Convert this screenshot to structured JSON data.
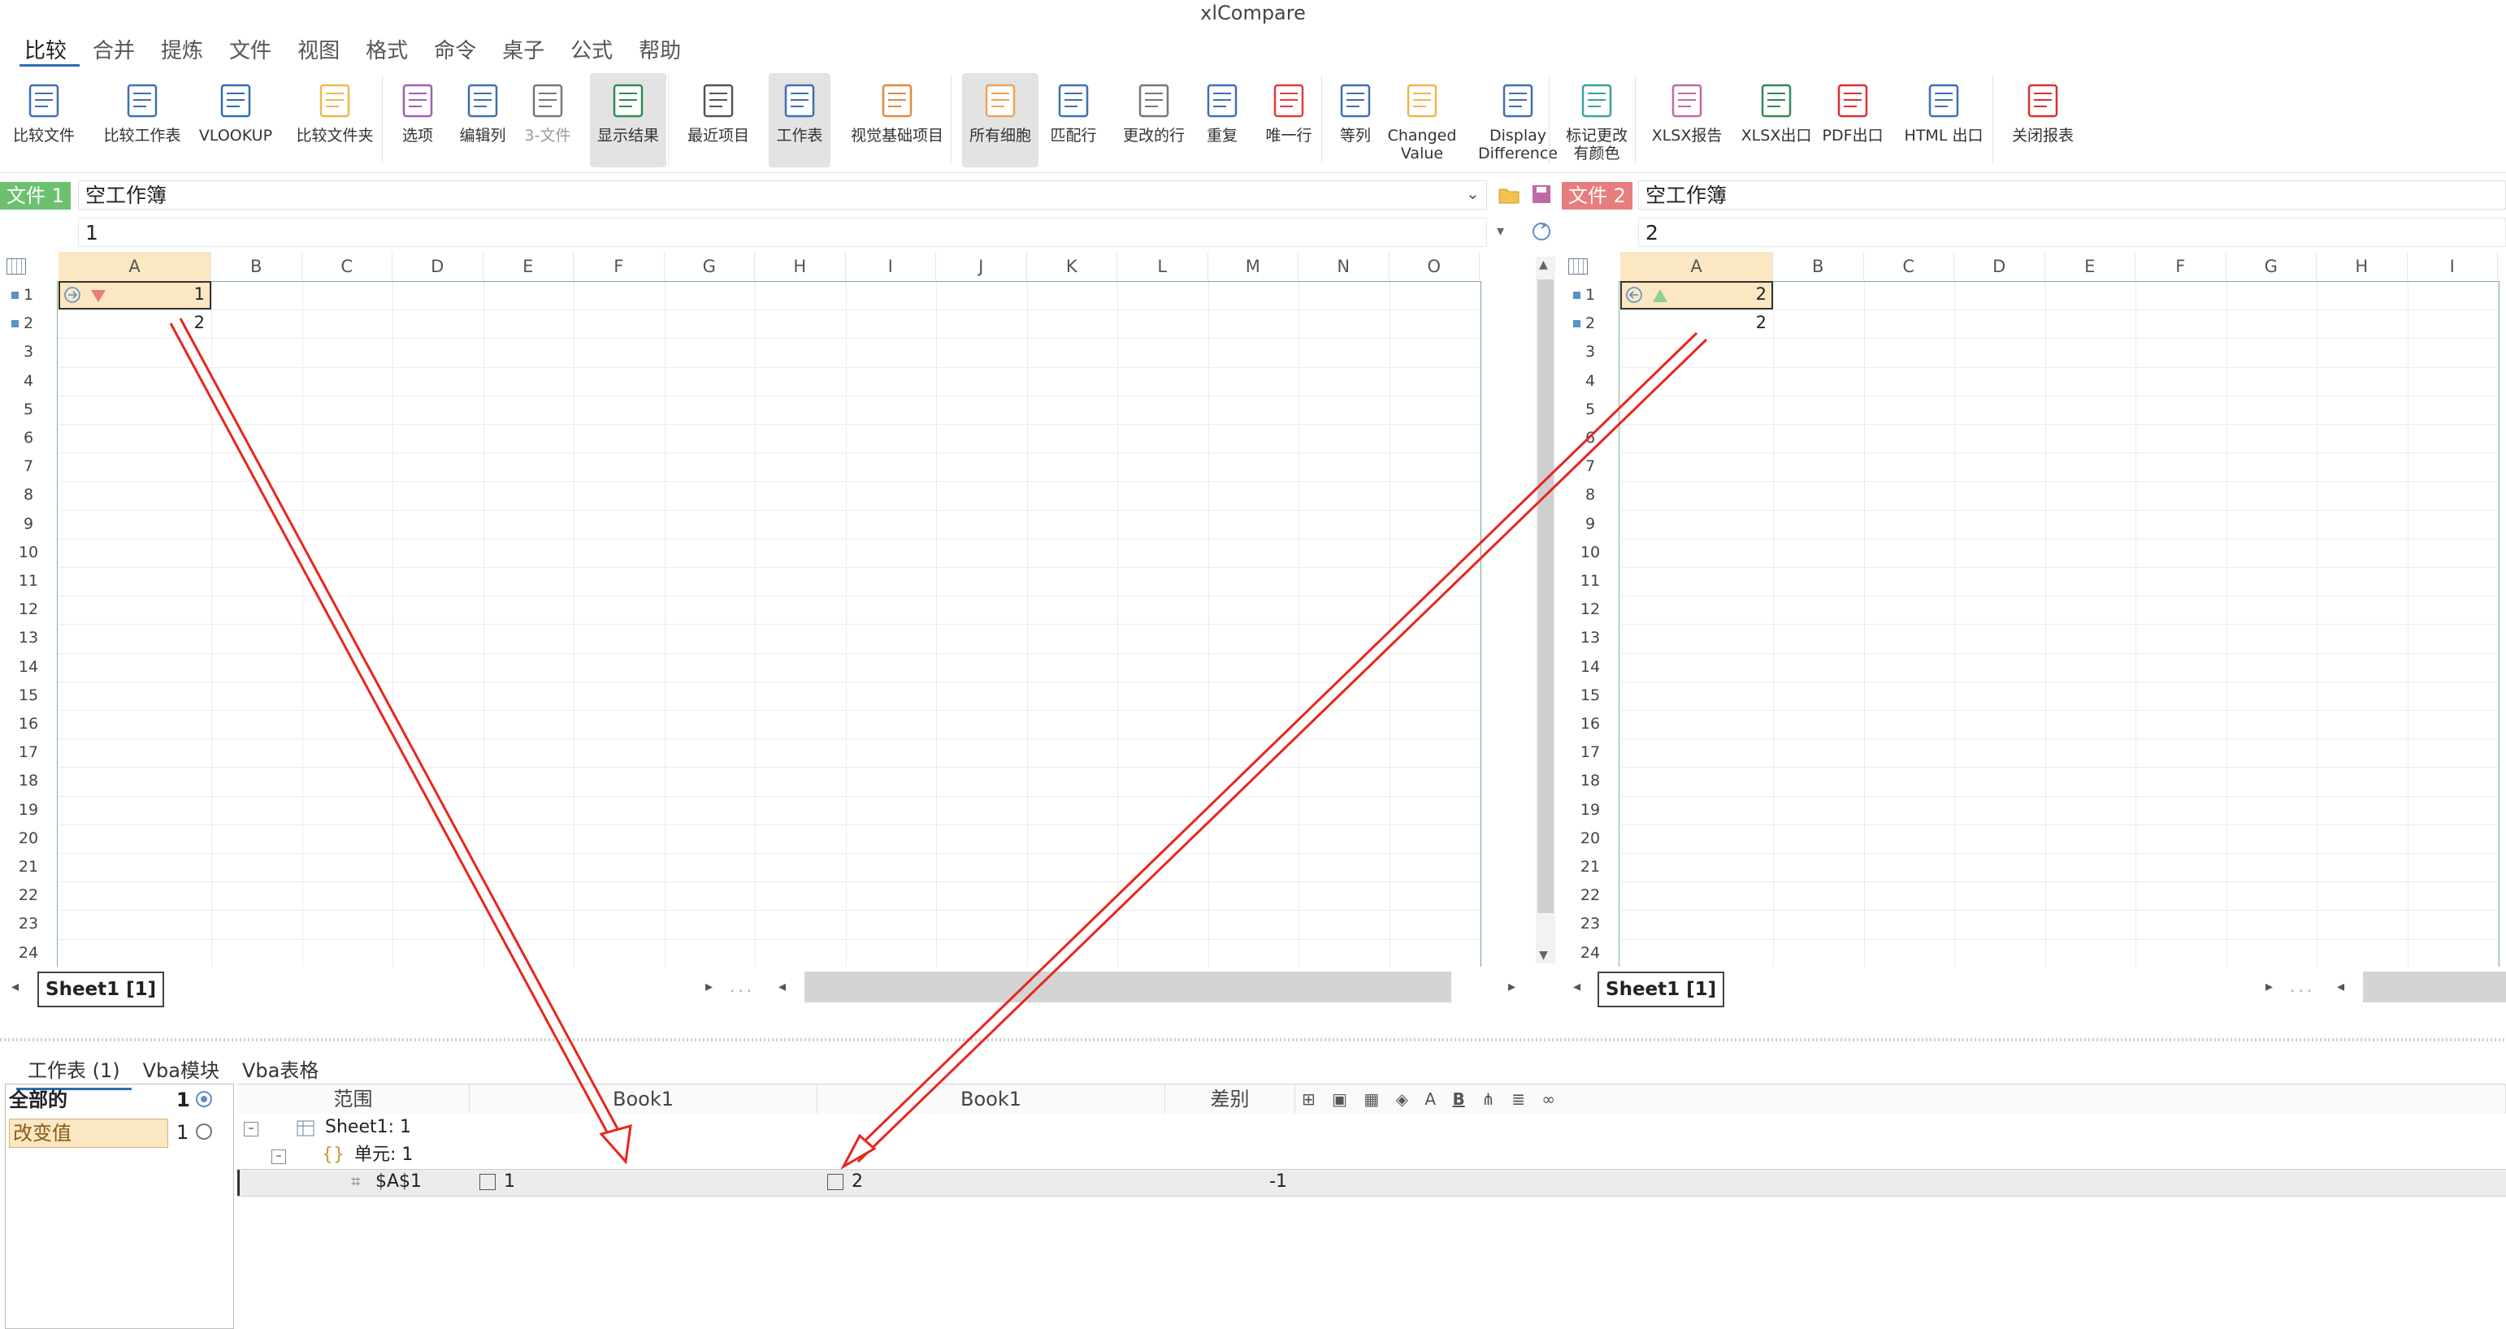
{
  "app_title": "xlCompare",
  "menu": [
    "比较",
    "合并",
    "提炼",
    "文件",
    "视图",
    "格式",
    "命令",
    "桌子",
    "公式",
    "帮助"
  ],
  "ribbon": [
    {
      "label": "比较文件",
      "icon": "compare-file-icon"
    },
    {
      "label": "比较工作表",
      "icon": "compare-sheets-icon"
    },
    {
      "label": "VLOOKUP",
      "icon": "vlookup-icon"
    },
    {
      "label": "比较文件夹",
      "icon": "compare-folder-icon"
    },
    {
      "label": "选项",
      "icon": "gear-icon"
    },
    {
      "label": "编辑列",
      "icon": "edit-columns-icon"
    },
    {
      "label": "3-文件",
      "icon": "three-file-icon"
    },
    {
      "label": "显示结果",
      "icon": "show-results-icon"
    },
    {
      "label": "最近项目",
      "icon": "recent-icon"
    },
    {
      "label": "工作表",
      "icon": "worksheet-icon"
    },
    {
      "label": "视觉基础项目",
      "icon": "vba-project-icon"
    },
    {
      "label": "所有细胞",
      "icon": "all-cells-icon"
    },
    {
      "label": "匹配行",
      "icon": "match-rows-icon"
    },
    {
      "label": "更改的行",
      "icon": "changed-rows-icon"
    },
    {
      "label": "重复",
      "icon": "duplicates-icon"
    },
    {
      "label": "唯一行",
      "icon": "unique-rows-icon"
    },
    {
      "label": "等列",
      "icon": "equal-columns-icon"
    },
    {
      "label": "Changed\nValue",
      "icon": "changed-value-icon"
    },
    {
      "label": "Display\nDifference",
      "icon": "display-difference-icon"
    },
    {
      "label": "标记更改\n有颜色",
      "icon": "mark-color-icon"
    },
    {
      "label": "XLSX报告",
      "icon": "xlsx-report-icon"
    },
    {
      "label": "XLSX出口",
      "icon": "xlsx-export-icon"
    },
    {
      "label": "PDF出口",
      "icon": "pdf-export-icon"
    },
    {
      "label": "HTML 出口",
      "icon": "html-export-icon"
    },
    {
      "label": "关闭报表",
      "icon": "close-report-icon"
    }
  ],
  "file1": {
    "tag": "文件 1",
    "workbook": "空工作簿",
    "cell_value": "1"
  },
  "file2": {
    "tag": "文件 2",
    "workbook": "空工作簿",
    "cell_value": "2"
  },
  "grid_left": {
    "columns": [
      "A",
      "B",
      "C",
      "D",
      "E",
      "F",
      "G",
      "H",
      "I",
      "J",
      "K",
      "L",
      "M",
      "N",
      "O"
    ],
    "rows": [
      "1",
      "2",
      "3",
      "4",
      "5",
      "6",
      "7",
      "8",
      "9",
      "10",
      "11",
      "12",
      "13",
      "14",
      "15",
      "16",
      "17",
      "18",
      "19",
      "20",
      "21",
      "22",
      "23",
      "24"
    ],
    "a1": "1",
    "a2": "2",
    "sheet_tab": "Sheet1 [1]",
    "dots": "..."
  },
  "grid_right": {
    "columns": [
      "A",
      "B",
      "C",
      "D",
      "E",
      "F",
      "G",
      "H",
      "I"
    ],
    "rows": [
      "1",
      "2",
      "3",
      "4",
      "5",
      "6",
      "7",
      "8",
      "9",
      "10",
      "11",
      "12",
      "13",
      "14",
      "15",
      "16",
      "17",
      "18",
      "19",
      "20",
      "21",
      "22",
      "23",
      "24"
    ],
    "a1": "2",
    "a2": "2",
    "sheet_tab": "Sheet1 [1]",
    "dots": "..."
  },
  "bottom_tabs": [
    "工作表 (1)",
    "Vba模块",
    "Vba表格"
  ],
  "filters": [
    {
      "label": "全部的",
      "count": "1"
    },
    {
      "label": "改变值",
      "count": "1"
    }
  ],
  "results": {
    "headers": [
      "范围",
      "Book1",
      "Book1",
      "差别"
    ],
    "sheet_node": "Sheet1: 1",
    "cell_node": "单元: 1",
    "row": {
      "address": "$A$1",
      "left": "1",
      "right": "2",
      "diff": "-1"
    }
  },
  "colors": {
    "file1_tag": "#6cc070",
    "file2_tag": "#e87d7d",
    "selection": "#fbe7c1",
    "arrow": "#e8261d",
    "grid_border": "#7fb58a"
  }
}
